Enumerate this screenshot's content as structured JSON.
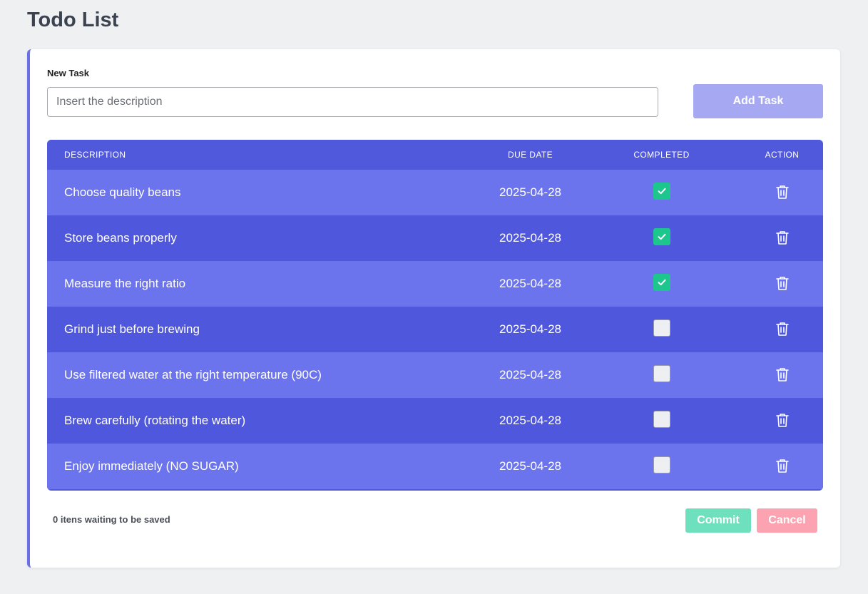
{
  "page": {
    "title": "Todo List"
  },
  "form": {
    "label": "New Task",
    "input_value": "",
    "placeholder": "Insert the description",
    "add_button": "Add Task"
  },
  "table": {
    "headers": {
      "description": "DESCRIPTION",
      "due_date": "DUE DATE",
      "completed": "COMPLETED",
      "action": "ACTION"
    },
    "rows": [
      {
        "description": "Choose quality beans",
        "due_date": "2025-04-28",
        "completed": true
      },
      {
        "description": "Store beans properly",
        "due_date": "2025-04-28",
        "completed": true
      },
      {
        "description": "Measure the right ratio",
        "due_date": "2025-04-28",
        "completed": true
      },
      {
        "description": "Grind just before brewing",
        "due_date": "2025-04-28",
        "completed": false
      },
      {
        "description": "Use filtered water at the right temperature (90C)",
        "due_date": "2025-04-28",
        "completed": false
      },
      {
        "description": "Brew carefully (rotating the water)",
        "due_date": "2025-04-28",
        "completed": false
      },
      {
        "description": "Enjoy immediately (NO SUGAR)",
        "due_date": "2025-04-28",
        "completed": false
      }
    ],
    "action_icon": "trash-icon",
    "check_icon": "checkmark-icon"
  },
  "footer": {
    "status": "0 itens waiting to be saved",
    "commit_button": "Commit",
    "cancel_button": "Cancel"
  },
  "colors": {
    "accent": "#5058dc",
    "row_light": "#6b74ec",
    "row_dark": "#4f57dc",
    "checked": "#1cc68d",
    "commit": "#6fe0bd",
    "cancel": "#fba3b0",
    "add_button": "#a6a9f2"
  }
}
